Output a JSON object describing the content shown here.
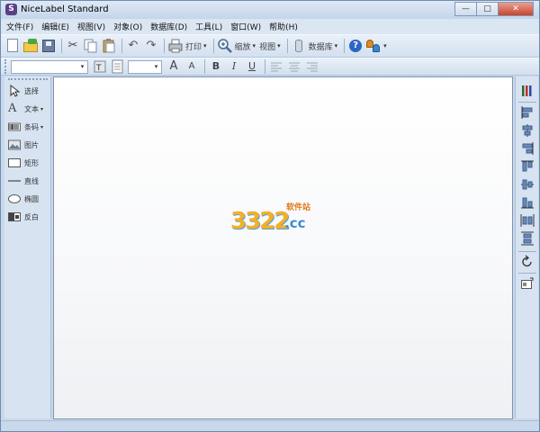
{
  "window": {
    "title": "NiceLabel Standard",
    "app_icon_glyph": "S",
    "controls": {
      "minimize": "—",
      "maximize": "□",
      "close": "✕"
    }
  },
  "menu": {
    "items": [
      "文件(F)",
      "编辑(E)",
      "视图(V)",
      "对象(O)",
      "数据库(D)",
      "工具(L)",
      "窗口(W)",
      "帮助(H)"
    ]
  },
  "toolbar": {
    "print_label": "打印",
    "zoom_label": "缩放",
    "view_label": "视图",
    "database_label": "数据库",
    "dropdown_arrow": "▾"
  },
  "format_toolbar": {
    "font_name": "",
    "font_size": "",
    "grow_font": "A",
    "shrink_font": "A",
    "bold": "B",
    "italic": "I",
    "underline": "U"
  },
  "toolbox": {
    "items": [
      {
        "label": "选择",
        "icon": "cursor-icon",
        "has_menu": false
      },
      {
        "label": "文本",
        "icon": "text-icon",
        "has_menu": true
      },
      {
        "label": "条码",
        "icon": "barcode-icon",
        "has_menu": true
      },
      {
        "label": "图片",
        "icon": "picture-icon",
        "has_menu": false
      },
      {
        "label": "矩形",
        "icon": "rectangle-icon",
        "has_menu": false
      },
      {
        "label": "直线",
        "icon": "line-icon",
        "has_menu": false
      },
      {
        "label": "椭圆",
        "icon": "ellipse-icon",
        "has_menu": false
      },
      {
        "label": "反白",
        "icon": "inverse-icon",
        "has_menu": false
      }
    ]
  },
  "watermark": {
    "number": "3322",
    "domain": ".cc",
    "site": "软件站"
  },
  "colors": {
    "window_bg": "#c9d8ea",
    "menubar_bg": "#dbe6f3",
    "panel_bg": "#d7e3f1",
    "accent_blue": "#3b8dd0",
    "watermark_orange": "#f2b02a"
  }
}
